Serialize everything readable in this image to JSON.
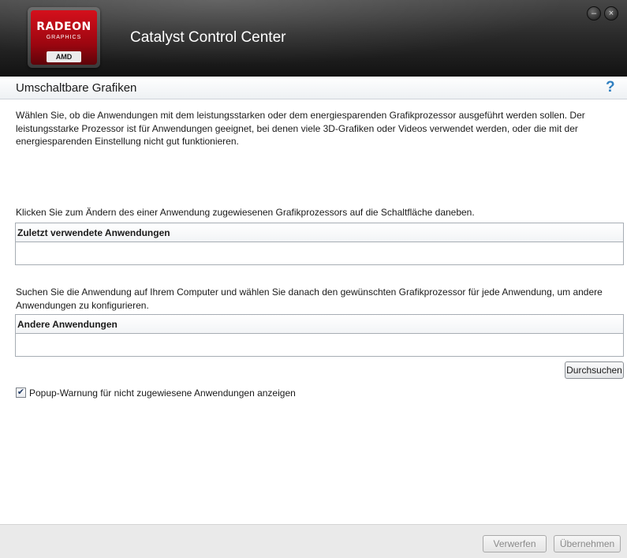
{
  "window": {
    "app_title": "Catalyst Control Center",
    "logo": {
      "brand": "RADEON",
      "subtitle": "GRAPHICS",
      "vendor": "AMD"
    },
    "controls": {
      "minimize_glyph": "–",
      "close_glyph": "×"
    }
  },
  "section": {
    "title": "Umschaltbare Grafiken",
    "help_glyph": "?"
  },
  "content": {
    "description": "Wählen Sie, ob die Anwendungen mit dem leistungsstarken oder dem energiesparenden Grafikprozessor ausgeführt werden sollen. Der leistungsstarke Prozessor ist für Anwendungen geeignet, bei denen viele 3D-Grafiken oder Videos verwendet werden, oder die mit der energiesparenden Einstellung nicht gut funktionieren.",
    "instruction_recent": "Klicken Sie zum Ändern des einer Anwendung zugewiesenen Grafikprozessors auf die Schaltfläche daneben.",
    "recent_header": "Zuletzt verwendete Anwendungen",
    "instruction_other": "Suchen Sie die Anwendung auf Ihrem Computer und wählen Sie danach den gewünschten Grafikprozessor für jede Anwendung, um andere Anwendungen zu konfigurieren.",
    "other_header": "Andere Anwendungen",
    "browse_label": "Durchsuchen",
    "popup_checkbox": {
      "label": "Popup-Warnung für nicht zugewiesene Anwendungen anzeigen",
      "checked": true,
      "glyph": "✔"
    }
  },
  "footer": {
    "discard_label": "Verwerfen",
    "apply_label": "Übernehmen"
  },
  "colors": {
    "brand_red": "#c8101c",
    "help_blue": "#2f7fc0",
    "titlebar_dark": "#1e1e1e"
  },
  "icons": {
    "help": "help-icon",
    "minimize": "minimize-icon",
    "close": "close-icon",
    "checkmark": "checkmark-icon"
  }
}
